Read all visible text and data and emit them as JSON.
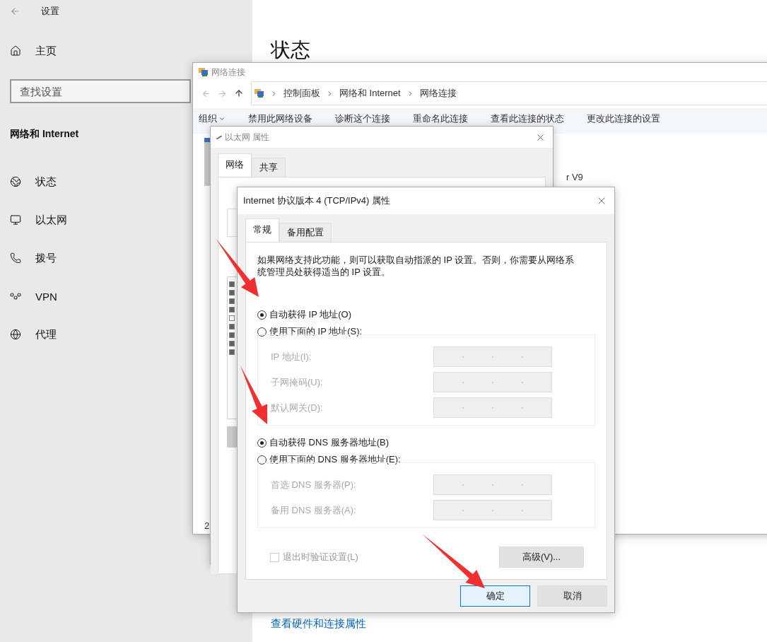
{
  "settings": {
    "title": "设置",
    "home": "主页",
    "search": {
      "placeholder": "查找设置"
    },
    "section": "网络和 Internet",
    "nav": [
      {
        "label": "状态",
        "kind": "status"
      },
      {
        "label": "以太网",
        "kind": "ethernet"
      },
      {
        "label": "拨号",
        "kind": "dialup"
      },
      {
        "label": "VPN",
        "kind": "vpn"
      },
      {
        "label": "代理",
        "kind": "proxy"
      }
    ],
    "page_title": "状态",
    "link": "查看硬件和连接属性"
  },
  "network_connections": {
    "title": "网络连接",
    "breadcrumb": [
      "控制面板",
      "网络和 Internet",
      "网络连接"
    ],
    "toolbar": [
      {
        "label": "组织",
        "dropdown": true
      },
      {
        "label": "禁用此网络设备",
        "dropdown": false
      },
      {
        "label": "诊断这个连接",
        "dropdown": false
      },
      {
        "label": "重命名此连接",
        "dropdown": false
      },
      {
        "label": "查看此连接的状态",
        "dropdown": false
      },
      {
        "label": "更改此连接的设置",
        "dropdown": false
      }
    ],
    "item_text": "r V9",
    "status": "2"
  },
  "ethernet_dialog": {
    "title": "以太网 属性",
    "tabs": [
      {
        "label": "网络",
        "selected": true
      },
      {
        "label": "共享",
        "selected": false
      }
    ],
    "items": [
      {
        "checked": true
      },
      {
        "checked": true
      },
      {
        "checked": true
      },
      {
        "checked": true
      },
      {
        "checked": false
      },
      {
        "checked": true
      },
      {
        "checked": true
      },
      {
        "checked": true
      },
      {
        "checked": true
      }
    ]
  },
  "tcp_dialog": {
    "title": "Internet 协议版本 4 (TCP/IPv4) 属性",
    "tabs": [
      {
        "label": "常规",
        "selected": true
      },
      {
        "label": "备用配置",
        "selected": false
      }
    ],
    "description": "如果网络支持此功能，则可以获取自动指派的 IP 设置。否则，你需要从网络系统管理员处获得适当的 IP 设置。",
    "ip_options": [
      {
        "label": "自动获得 IP 地址(O)",
        "selected": true
      },
      {
        "label": "使用下面的 IP 地址(S):",
        "selected": false
      }
    ],
    "ip_fields": [
      {
        "label": "IP 地址(I):",
        "disabled": true
      },
      {
        "label": "子网掩码(U):",
        "disabled": true
      },
      {
        "label": "默认网关(D):",
        "disabled": true
      }
    ],
    "dns_options": [
      {
        "label": "自动获得 DNS 服务器地址(B)",
        "selected": true
      },
      {
        "label": "使用下面的 DNS 服务器地址(E):",
        "selected": false
      }
    ],
    "dns_fields": [
      {
        "label": "首选 DNS 服务器(P):",
        "disabled": true
      },
      {
        "label": "备用 DNS 服务器(A):",
        "disabled": true
      }
    ],
    "validate": {
      "label": "退出时验证设置(L)",
      "checked": false,
      "disabled": true
    },
    "advanced_button": "高级(V)...",
    "buttons": [
      {
        "label": "确定",
        "default": true
      },
      {
        "label": "取消",
        "default": false
      }
    ]
  }
}
